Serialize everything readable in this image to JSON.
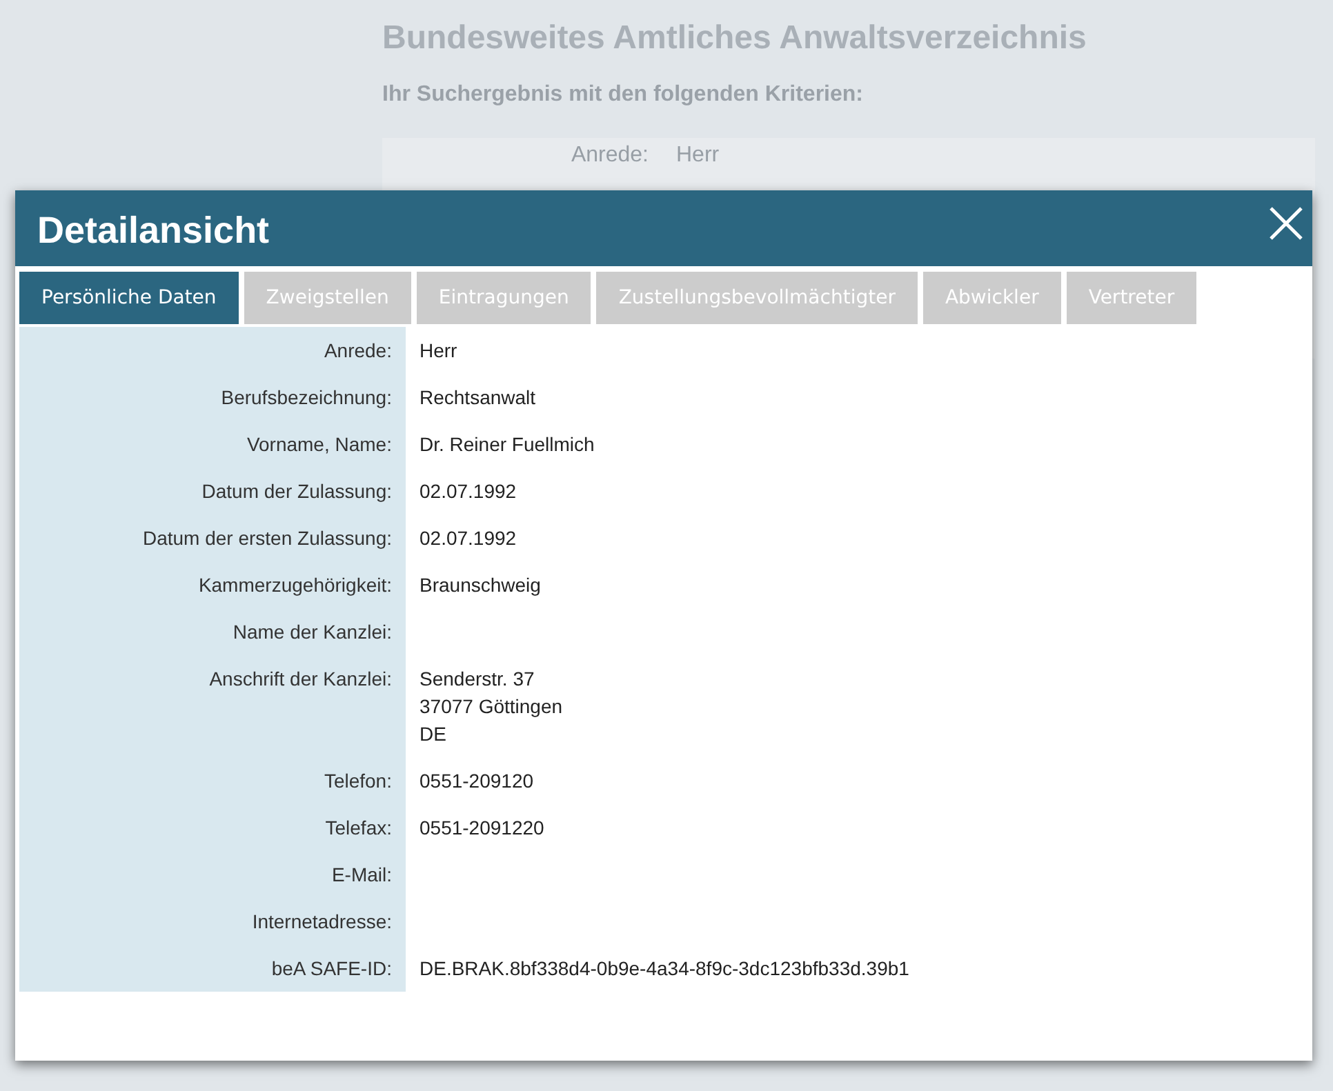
{
  "background": {
    "title": "Bundesweites Amtliches Anwaltsverzeichnis",
    "subtitle": "Ihr Suchergebnis mit den folgenden Kriterien:",
    "criteria": [
      {
        "label": "Anrede:",
        "value": "Herr"
      }
    ]
  },
  "dialog": {
    "title": "Detailansicht",
    "tabs": [
      {
        "label": "Persönliche Daten",
        "selected": true
      },
      {
        "label": "Zweigstellen",
        "selected": false
      },
      {
        "label": "Eintragungen",
        "selected": false
      },
      {
        "label": "Zustellungsbevollmächtigter",
        "selected": false
      },
      {
        "label": "Abwickler",
        "selected": false
      },
      {
        "label": "Vertreter",
        "selected": false
      }
    ],
    "fields": [
      {
        "label": "Anrede:",
        "value": [
          "Herr"
        ]
      },
      {
        "label": "Berufsbezeichnung:",
        "value": [
          "Rechtsanwalt"
        ]
      },
      {
        "label": "Vorname, Name:",
        "value": [
          "Dr. Reiner Fuellmich"
        ]
      },
      {
        "label": "Datum der Zulassung:",
        "value": [
          "02.07.1992"
        ]
      },
      {
        "label": "Datum der ersten Zulassung:",
        "value": [
          "02.07.1992"
        ]
      },
      {
        "label": "Kammerzugehörigkeit:",
        "value": [
          "Braunschweig"
        ]
      },
      {
        "label": "Name der Kanzlei:"
      },
      {
        "label": "Anschrift der Kanzlei:",
        "value": [
          "Senderstr. 37",
          "37077 Göttingen",
          "DE"
        ]
      },
      {
        "label": "Telefon:",
        "value": [
          "0551-209120"
        ]
      },
      {
        "label": "Telefax:",
        "value": [
          "0551-2091220"
        ]
      },
      {
        "label": "E-Mail:"
      },
      {
        "label": "Internetadresse:"
      },
      {
        "label": "beA SAFE-ID:",
        "value": [
          "DE.BRAK.8bf338d4-0b9e-4a34-8f9c-3dc123bfb33d.39b1"
        ]
      }
    ]
  }
}
